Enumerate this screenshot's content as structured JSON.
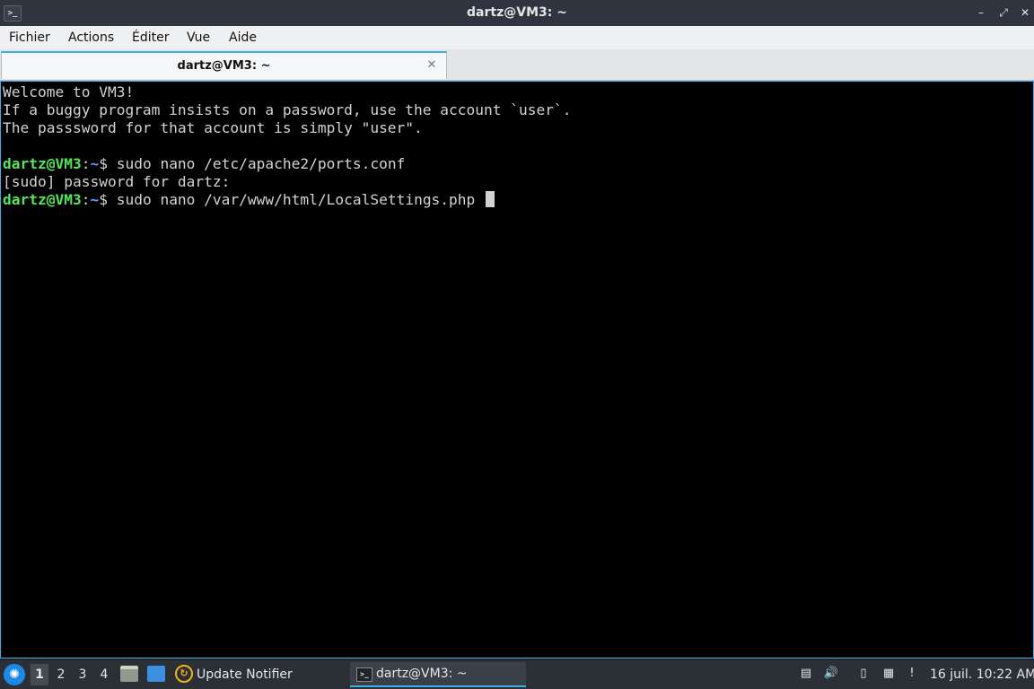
{
  "window": {
    "title": "dartz@VM3: ~",
    "app_icon": "terminal-icon",
    "buttons": {
      "minimize": "–",
      "maximize": "⤢",
      "close": "✕"
    }
  },
  "menu": [
    "Fichier",
    "Actions",
    "Éditer",
    "Vue",
    "Aide"
  ],
  "tabs": [
    {
      "label": "dartz@VM3: ~",
      "close": "✕"
    }
  ],
  "terminal": {
    "colors": {
      "user": "#56e35a",
      "path": "#5aa2ff",
      "text": "#d2d2d2",
      "background": "#000000"
    },
    "lines": {
      "welcome": "Welcome to VM3!",
      "info1": "If a buggy program insists on a password, use the account `user`.",
      "info2": "The passsword for that account is simply \"user\".",
      "sudo_prompt": "[sudo] password for dartz:"
    },
    "prompt": {
      "user": "dartz@VM3",
      "sep": ":",
      "path": "~",
      "symbol": "$"
    },
    "commands": {
      "cmd1": " sudo nano /etc/apache2/ports.conf",
      "cmd2": " sudo nano /var/www/html/LocalSettings.php "
    }
  },
  "taskbar": {
    "start_icon": "lxqt-start-icon",
    "start_glyph": "✺",
    "workspaces": [
      "1",
      "2",
      "3",
      "4"
    ],
    "active_workspace": "1",
    "quicklaunch": [
      "file-manager-icon",
      "show-desktop-icon"
    ],
    "update_notifier": {
      "label": "Update Notifier",
      "glyph": "↻"
    },
    "task": {
      "label": "dartz@VM3: ~"
    },
    "tray_icons": {
      "drive": "▤",
      "volume": "🔊",
      "clipboard": "▯",
      "network": "▦",
      "notification": "!"
    },
    "clock": "16 juil. 10:22 AM"
  }
}
